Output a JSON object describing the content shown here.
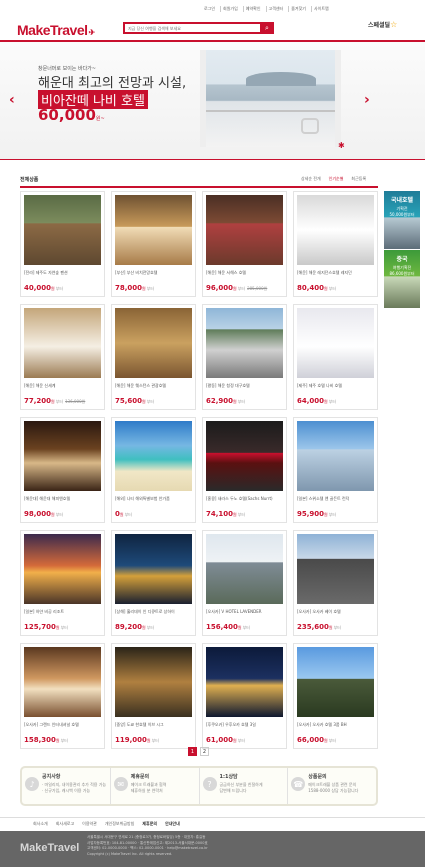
{
  "util_links": [
    "로그인",
    "회원가입",
    "예약확인",
    "고객센터",
    "즐겨찾기",
    "사이트맵"
  ],
  "header": {
    "logo": "MakeTravel",
    "search_placeholder": "지금 당신 여행을 검색해 보세요",
    "special_label": "스페셜딜"
  },
  "banner": {
    "sub": "창문너머로 보이는 바다가~",
    "line1": "해운대 최고의 전망과 시설,",
    "line2": "비아잔떼 나비 호텔",
    "price": "60,000",
    "price_unit": "원~"
  },
  "section": {
    "title": "전체상품",
    "sort": [
      "상세순 전개",
      "인기순별",
      "최근등록"
    ],
    "sort_active": 1
  },
  "products": [
    {
      "name": "[전라] 제주도 자연숲 펜션",
      "price": "40,000",
      "orig": ""
    },
    {
      "name": "[부산] 부산 비치전망호텔",
      "price": "78,000",
      "orig": ""
    },
    {
      "name": "[해운] 해운 서해스 호텔",
      "price": "96,000",
      "orig": "285,000원"
    },
    {
      "name": "[해운] 해운 레지던스호텔 레지던",
      "price": "80,400",
      "orig": ""
    },
    {
      "name": "[해운] 해운 신세계",
      "price": "77,200",
      "orig": "136,000원"
    },
    {
      "name": "[해운] 해운 웨스턴스 관광호텔",
      "price": "75,600",
      "orig": ""
    },
    {
      "name": "[평동] 해운 청정 대구호텔",
      "price": "62,900",
      "orig": ""
    },
    {
      "name": "[제주] 제주 호텔 나비 호텔",
      "price": "64,000",
      "orig": ""
    },
    {
      "name": "[해운대] 해운대 해피엔호텔",
      "price": "98,000",
      "orig": ""
    },
    {
      "name": "[해외] 나티 해외특별보험 안가품",
      "price": "0",
      "orig": ""
    },
    {
      "name": "[홍콩] 새라스 두노 호텔(Sachs Nurrt)",
      "price": "74,100",
      "orig": ""
    },
    {
      "name": "[일본] 스위소텔 앤 골든트 런덕",
      "price": "95,900",
      "orig": ""
    },
    {
      "name": "[일본] 하얀 비공 리조트",
      "price": "125,700",
      "orig": ""
    },
    {
      "name": "[상해] 훌리데이 인 디큐트로 상하이",
      "price": "89,200",
      "orig": ""
    },
    {
      "name": "[오사카] V HOTEL LAVENDER",
      "price": "156,400",
      "orig": ""
    },
    {
      "name": "[오사카] 오사카 베이 호텔",
      "price": "235,600",
      "orig": ""
    },
    {
      "name": "[오사카] 그랜드 인터내셔널 호텔",
      "price": "158,300",
      "orig": ""
    },
    {
      "name": "[중앙] 도쿄 한호텔 이브 시그",
      "price": "119,000",
      "orig": ""
    },
    {
      "name": "[후쿠오카] 우후오카 호텔 3일",
      "price": "61,000",
      "orig": ""
    },
    {
      "name": "[오사카] 오사카 호텔 3품 BH",
      "price": "66,000",
      "orig": ""
    }
  ],
  "price_unit": "원",
  "price_suffix": "부터",
  "side_ads": [
    {
      "title": "국내호텔",
      "sub": "기획전",
      "price": "50,000원부터"
    },
    {
      "title": "중국",
      "sub": "여행기획전",
      "price": "86,600원부터"
    }
  ],
  "pages": [
    "1",
    "2"
  ],
  "info": [
    {
      "title": "공지사항",
      "icon": "speaker-icon",
      "lines": [
        "· 마일리지, 내이용관리 추가 적용 가능",
        "· 신규가입, 캐시백 이용 가능"
      ]
    },
    {
      "title": "제휴문의",
      "icon": "mail-icon",
      "lines": [
        "메이크 트래블과 협력",
        "제휴하실 분 연락처"
      ]
    },
    {
      "title": "1:1상담",
      "icon": "chat-icon",
      "lines": [
        "궁금하신 부분을 친절하게",
        "답변해 드립니다"
      ]
    },
    {
      "title": "상품문의",
      "icon": "phone-icon",
      "lines": [
        "메이크트래블 상품 관련 문의",
        "1588-0000 상담 가능합니다"
      ]
    }
  ],
  "footer_links": [
    "회사소개",
    "회사새로고",
    "이용약관",
    "개인정보취급방침",
    "제휴문의",
    "안내안내"
  ],
  "footer_link_bold": [
    4,
    5
  ],
  "footer": {
    "logo": "MakeTravel",
    "lines": [
      "서울특별시 서대문구 연세로 21 (충정로3가, 충정로바빌딩) 5층 · 대표자: 홍길동",
      "사업자등록번호: 104-81-00000 · 통신판매업신고: 제2013-서울서대문-0000호",
      "고객센터: 02-0000-0000 · 팩스: 02-0000-0001 · help@maketravel.co.kr",
      "Copyright (c) MakeTravel Inc. All rights reserved."
    ]
  }
}
